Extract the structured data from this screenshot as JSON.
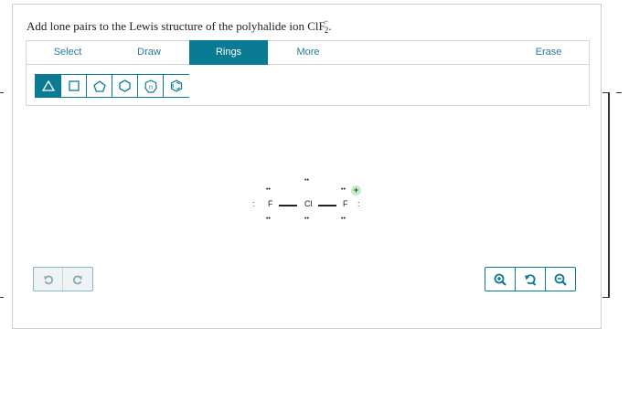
{
  "question": {
    "prefix": "Add lone pairs to the Lewis structure of the polyhalide ion ClF",
    "subscript": "2",
    "superscript": "−",
    "suffix": "."
  },
  "tabs": [
    {
      "label": "Select",
      "active": false
    },
    {
      "label": "Draw",
      "active": false
    },
    {
      "label": "Rings",
      "active": true
    },
    {
      "label": "More",
      "active": false
    },
    {
      "label": "Erase",
      "active": false
    }
  ],
  "ring_tools": [
    {
      "icon": "triangle-ring-icon",
      "selected": true
    },
    {
      "icon": "square-ring-icon",
      "selected": false
    },
    {
      "icon": "pentagon-ring-icon",
      "selected": false
    },
    {
      "icon": "hexagon-ring-icon",
      "selected": false
    },
    {
      "icon": "n-ring-icon",
      "label": "n",
      "selected": false
    },
    {
      "icon": "benzene-ring-icon",
      "selected": false
    }
  ],
  "molecule": {
    "atoms": [
      {
        "symbol": "F"
      },
      {
        "symbol": "Cl"
      },
      {
        "symbol": "F"
      }
    ],
    "charge": "+",
    "lone_pair_glyph": "••",
    "lone_pair_vertical": ":"
  },
  "controls": {
    "undo_icon": "undo-icon",
    "redo_icon": "redo-icon",
    "zoom_in_icon": "zoom-in-icon",
    "zoom_reset_icon": "zoom-reset-icon",
    "zoom_out_icon": "zoom-out-icon"
  },
  "colors": {
    "accent": "#0b7a93",
    "tab_text": "#2a7a99",
    "charge_bg": "#c9e8c9",
    "charge_fg": "#0a6b0a",
    "disabled": "#8aa9b4"
  }
}
